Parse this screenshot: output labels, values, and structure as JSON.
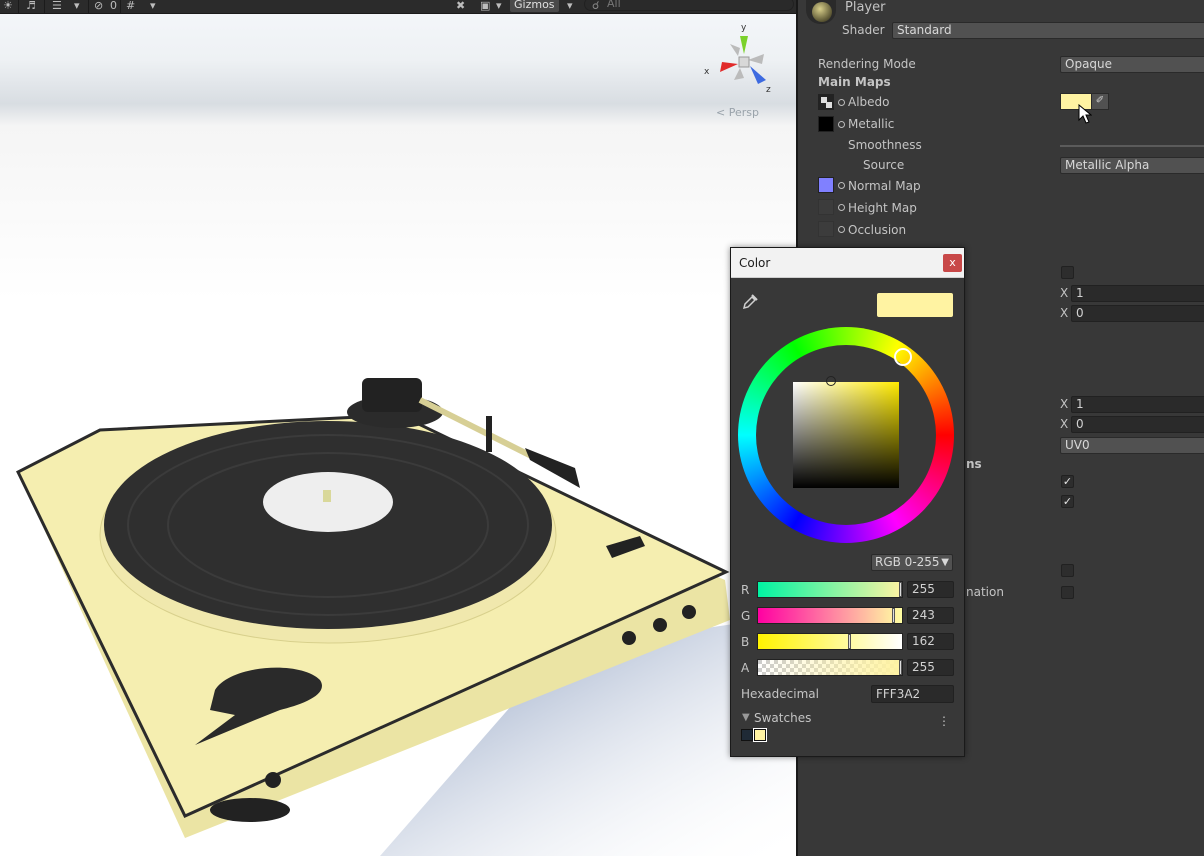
{
  "scene": {
    "toolbar": {
      "hidden_count": "0",
      "gizmos_label": "Gizmos",
      "search_placeholder": "All"
    },
    "persp_label": "< Persp",
    "axis": {
      "x": "x",
      "y": "y",
      "z": "z"
    }
  },
  "inspector": {
    "material_name": "Player",
    "shader_label": "Shader",
    "shader_value": "Standard",
    "rendering_mode_label": "Rendering Mode",
    "rendering_mode_value": "Opaque",
    "main_maps_label": "Main Maps",
    "albedo_label": "Albedo",
    "albedo_color": "#FFF3A2",
    "metallic_label": "Metallic",
    "smoothness_label": "Smoothness",
    "source_label": "Source",
    "source_value": "Metallic Alpha",
    "normal_map_label": "Normal Map",
    "height_map_label": "Height Map",
    "occlusion_label": "Occlusion",
    "tiling_x_label": "X",
    "tiling_x_value": "1",
    "offset_x_label": "X",
    "offset_x_value": "0",
    "tiling2_x_label": "X",
    "tiling2_x_value": "1",
    "offset2_x_label": "X",
    "offset2_x_value": "0",
    "uv_set_value": "UV0",
    "partial_ns_label": "ns",
    "partial_nation_label": "nation"
  },
  "color_picker": {
    "title": "Color",
    "close_label": "x",
    "preview_color": "#FFF3A2",
    "mode_label": "RGB 0-255",
    "channels": [
      {
        "label": "R",
        "value": "255",
        "level": 1.0
      },
      {
        "label": "G",
        "value": "243",
        "level": 0.953
      },
      {
        "label": "B",
        "value": "162",
        "level": 0.635
      },
      {
        "label": "A",
        "value": "255",
        "level": 1.0
      }
    ],
    "hex_label": "Hexadecimal",
    "hex_value": "FFF3A2",
    "swatches_label": "Swatches",
    "swatch_colors": [
      "#1f2a36",
      "#FFF3A2"
    ]
  }
}
